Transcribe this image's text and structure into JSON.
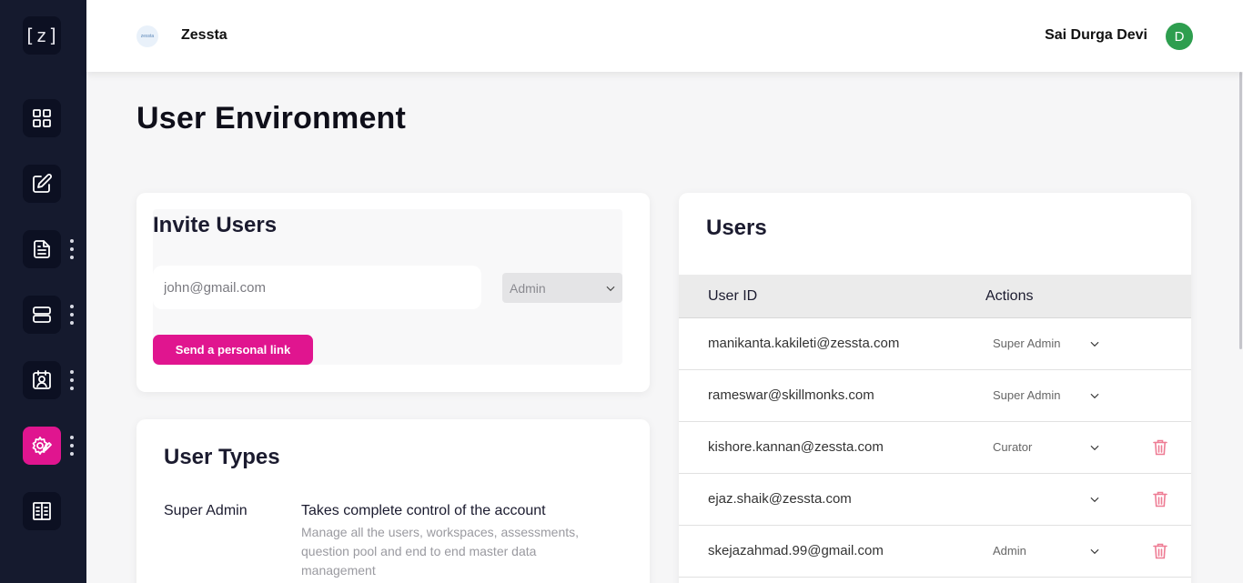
{
  "sidebar": {
    "logo_text": "[z]",
    "items": [
      {
        "icon": "dashboard-grid-icon",
        "has_menu": false,
        "active": false
      },
      {
        "icon": "edit-icon",
        "has_menu": false,
        "active": false
      },
      {
        "icon": "document-icon",
        "has_menu": true,
        "active": false
      },
      {
        "icon": "server-icon",
        "has_menu": true,
        "active": false
      },
      {
        "icon": "contact-card-icon",
        "has_menu": true,
        "active": false
      },
      {
        "icon": "settings-edit-icon",
        "has_menu": true,
        "active": true
      },
      {
        "icon": "building-list-icon",
        "has_menu": false,
        "active": false
      }
    ],
    "active_color": "#e0158f"
  },
  "header": {
    "org_logo_text": "zessta",
    "org_name": "Zessta",
    "user_name": "Sai Durga Devi",
    "avatar_initial": "D",
    "avatar_color": "#2e9e4f"
  },
  "page": {
    "title": "User Environment"
  },
  "invite": {
    "title": "Invite Users",
    "email_placeholder": "john@gmail.com",
    "role_selected": "Admin",
    "send_label": "Send a personal link"
  },
  "user_types": {
    "title": "User Types",
    "items": [
      {
        "name": "Super Admin",
        "heading": "Takes complete control of the account",
        "description": "Manage all the users, workspaces, assessments, question pool and end to end master data management"
      }
    ]
  },
  "users": {
    "title": "Users",
    "columns": [
      "User ID",
      "Actions"
    ],
    "rows": [
      {
        "email": "manikanta.kakileti@zessta.com",
        "role": "Super Admin",
        "deletable": false
      },
      {
        "email": "rameswar@skillmonks.com",
        "role": "Super Admin",
        "deletable": false
      },
      {
        "email": "kishore.kannan@zessta.com",
        "role": "Curator",
        "deletable": true
      },
      {
        "email": "ejaz.shaik@zessta.com",
        "role": "",
        "deletable": true
      },
      {
        "email": "skejazahmad.99@gmail.com",
        "role": "Admin",
        "deletable": true
      }
    ]
  },
  "colors": {
    "accent": "#e0158f",
    "sidebar_bg": "#151a2e",
    "delete": "#ee7c94"
  }
}
